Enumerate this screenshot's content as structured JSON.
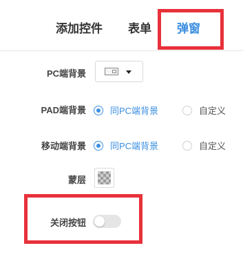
{
  "tabs": {
    "add_control": "添加控件",
    "form": "表单",
    "popup": "弹窗",
    "active": "popup"
  },
  "settings": {
    "pc_background": {
      "label": "PC端背景",
      "preview_icon": "image-placeholder-icon"
    },
    "pad_background": {
      "label": "PAD端背景",
      "options": [
        "同PC端背景",
        "自定义"
      ],
      "selected": "同PC端背景"
    },
    "mobile_background": {
      "label": "移动端背景",
      "options": [
        "同PC端背景",
        "自定义"
      ],
      "selected": "同PC端背景"
    },
    "mask": {
      "label": "蒙层",
      "preview_icon": "checkerboard-icon"
    },
    "close_button": {
      "label": "关闭按钮",
      "enabled": false
    }
  },
  "colors": {
    "accent": "#3c8fe0",
    "highlight": "#e8313a",
    "text": "#333333"
  }
}
